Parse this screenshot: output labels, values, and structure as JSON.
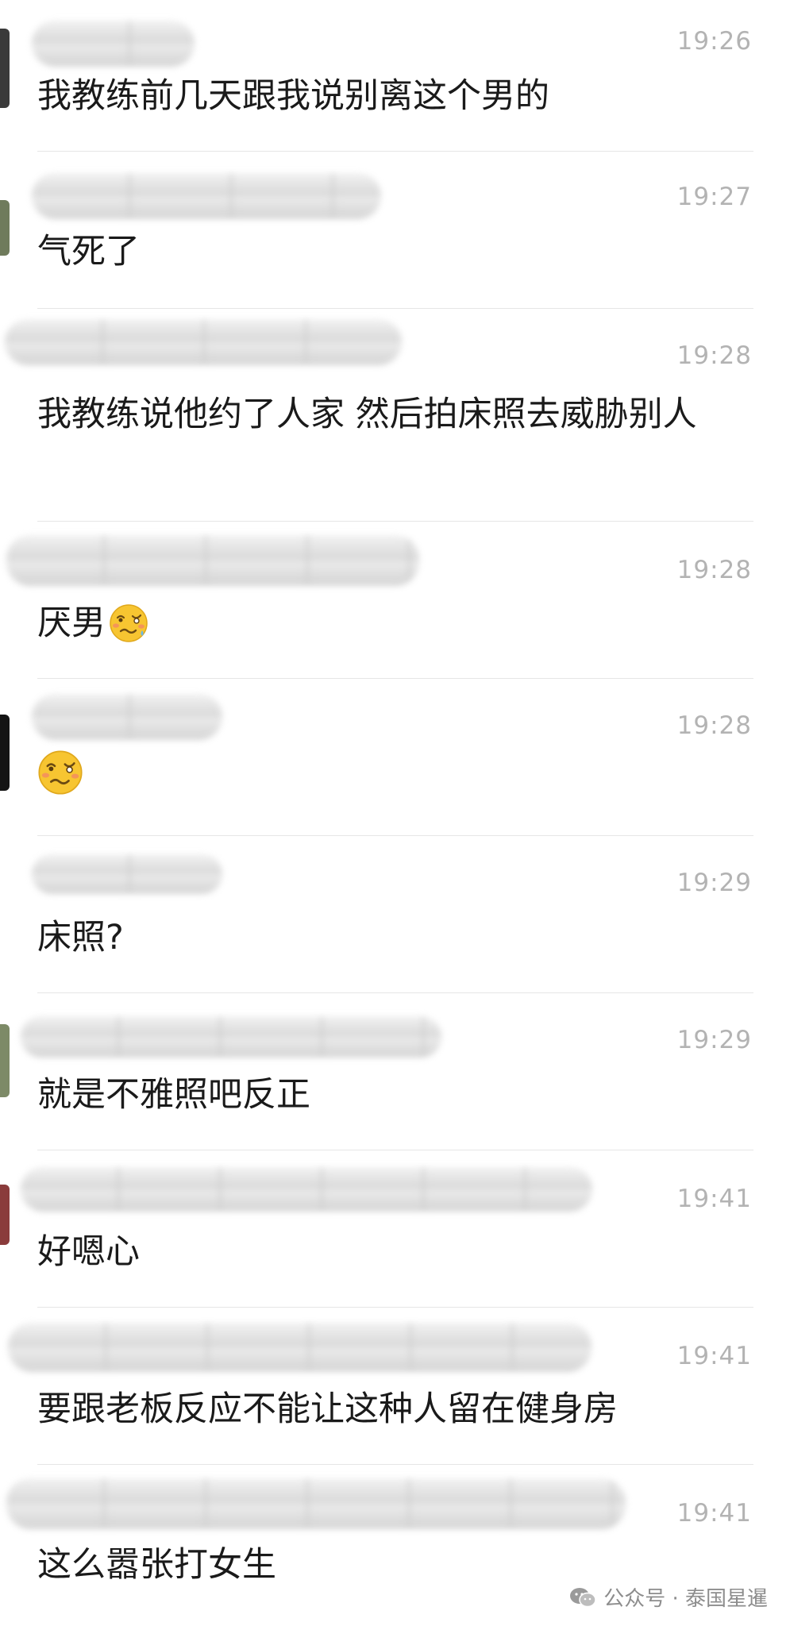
{
  "messages": [
    {
      "time": "19:26",
      "text": "我教练前几天跟我说别离这个男的",
      "emoji": ""
    },
    {
      "time": "19:27",
      "text": "气死了",
      "emoji": ""
    },
    {
      "time": "19:28",
      "text": "我教练说他约了人家 然后拍床照去威胁别人",
      "emoji": ""
    },
    {
      "time": "19:28",
      "text": "厌男",
      "emoji": "woozy-face-icon"
    },
    {
      "time": "19:28",
      "text": "",
      "emoji": "woozy-face-icon"
    },
    {
      "time": "19:29",
      "text": "床照?",
      "emoji": ""
    },
    {
      "time": "19:29",
      "text": "就是不雅照吧反正",
      "emoji": ""
    },
    {
      "time": "19:41",
      "text": "好嗯心",
      "emoji": ""
    },
    {
      "time": "19:41",
      "text": "要跟老板反应不能让这种人留在健身房",
      "emoji": ""
    },
    {
      "time": "19:41",
      "text": "这么嚣张打女生",
      "emoji": ""
    }
  ],
  "watermark": {
    "text": "公众号 · 泰国星暹",
    "icon": "wechat-icon"
  },
  "colors": {
    "time": "#b3b3b3",
    "text": "#1a1a1a",
    "divider": "#e6e6e6",
    "watermark": "#8d8d8d"
  }
}
